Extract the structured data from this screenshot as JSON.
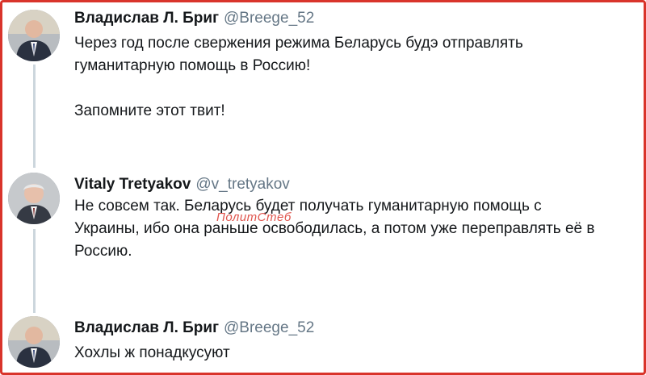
{
  "tweets": [
    {
      "display_name": "Владислав Л. Бриг",
      "handle": "@Breege_52",
      "lines": [
        "Через год после свержения режима Беларусь будэ отправлять",
        "гуманитарную помощь в Россию!",
        "",
        "Запомните этот твит!"
      ],
      "avatar_icon": "person-portrait-icon"
    },
    {
      "display_name": "Vitaly Tretyakov",
      "handle": "@v_tretyakov",
      "lines": [
        "Не совсем так. Беларусь будет получать гуманитарную помощь с",
        "Украины, ибо она раньше освободилась, а потом уже переправлять её в",
        "Россию."
      ],
      "avatar_icon": "person-portrait-icon"
    },
    {
      "display_name": "Владислав Л. Бриг",
      "handle": "@Breege_52",
      "lines": [
        "Хохлы ж понадкусуют"
      ],
      "avatar_icon": "person-portrait-icon"
    }
  ],
  "watermark": "ПолитСтеб",
  "colors": {
    "frame_border": "#d9342b",
    "thread_line": "#ccd6dd",
    "handle_text": "#657786",
    "watermark": "#e0554d"
  }
}
